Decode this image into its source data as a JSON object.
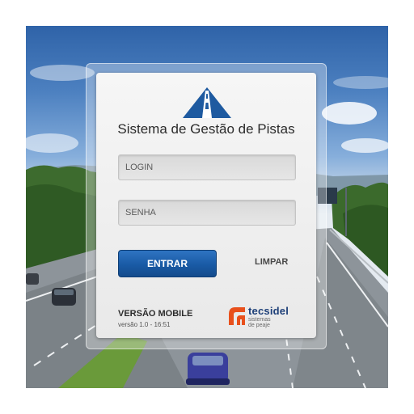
{
  "app": {
    "title": "Sistema de Gestão de Pistas"
  },
  "form": {
    "login_placeholder": "LOGIN",
    "login_value": "",
    "senha_placeholder": "SENHA",
    "senha_value": "",
    "entrar_label": "ENTRAR",
    "limpar_label": "LIMPAR"
  },
  "footer": {
    "mobile_label": "VERSÃO MOBILE",
    "version_text": "versão 1.0 - 16:51"
  },
  "brand": {
    "name": "tecsidel",
    "tagline_line1": "sistemas",
    "tagline_line2": "de peaje",
    "icon": "tecsidel-logo-icon",
    "accent_color": "#e8501c",
    "name_color": "#1d3f78"
  },
  "logo": {
    "icon": "highway-logo-icon",
    "color": "#1e5aa0"
  },
  "theme": {
    "button_color": "#195aa5"
  }
}
